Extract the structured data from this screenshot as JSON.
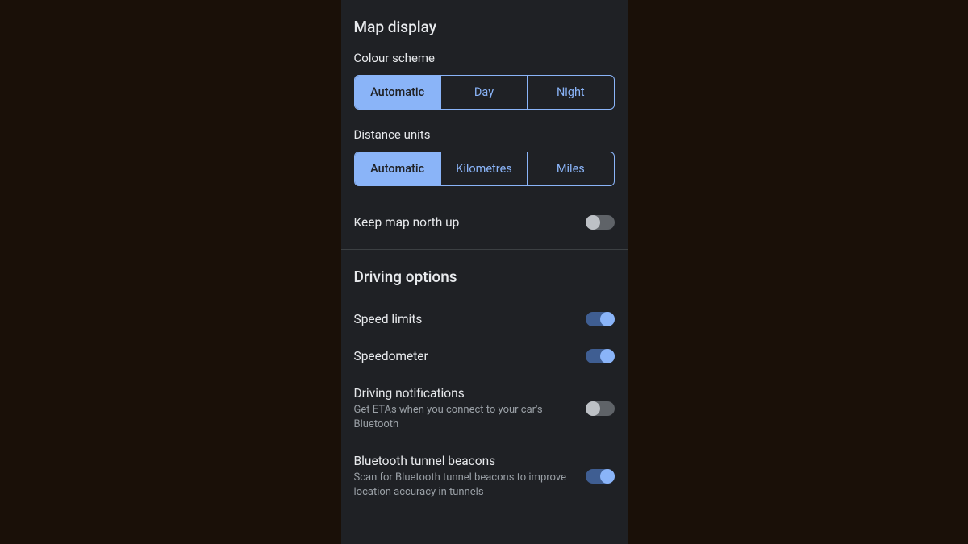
{
  "mapDisplay": {
    "title": "Map display",
    "colourScheme": {
      "label": "Colour scheme",
      "options": [
        "Automatic",
        "Day",
        "Night"
      ],
      "selected": 0
    },
    "distanceUnits": {
      "label": "Distance units",
      "options": [
        "Automatic",
        "Kilometres",
        "Miles"
      ],
      "selected": 0
    },
    "keepNorthUp": {
      "label": "Keep map north up",
      "value": false
    }
  },
  "drivingOptions": {
    "title": "Driving options",
    "speedLimits": {
      "label": "Speed limits",
      "value": true
    },
    "speedometer": {
      "label": "Speedometer",
      "value": true
    },
    "drivingNotifications": {
      "label": "Driving notifications",
      "subtitle": "Get ETAs when you connect to your car's Bluetooth",
      "value": false
    },
    "bluetoothTunnelBeacons": {
      "label": "Bluetooth tunnel beacons",
      "subtitle": "Scan for Bluetooth tunnel beacons to improve location accuracy in tunnels",
      "value": true
    }
  }
}
